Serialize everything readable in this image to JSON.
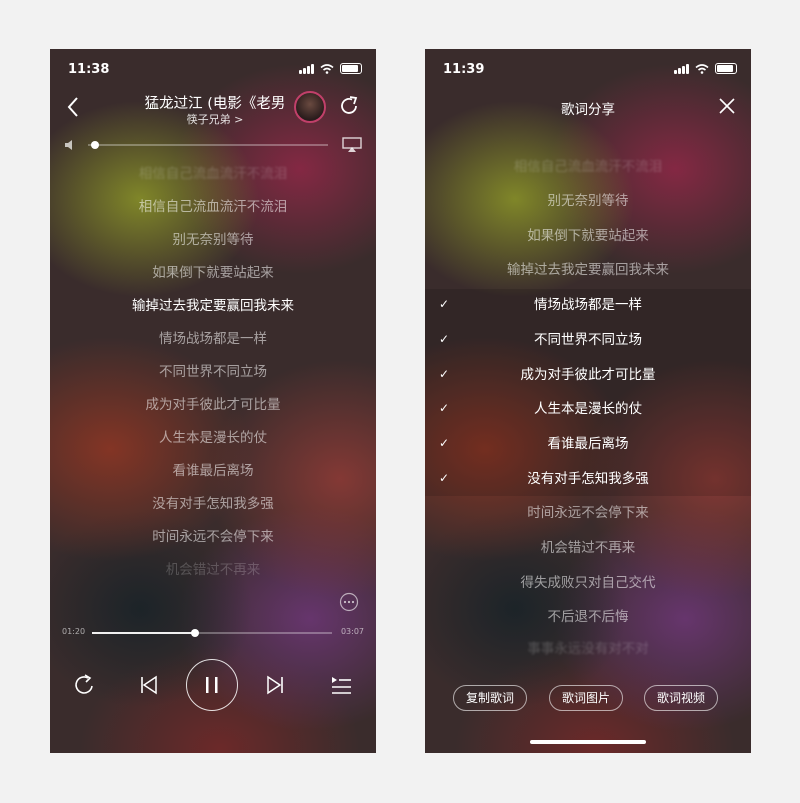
{
  "player": {
    "status_time": "11:38",
    "song_title": "猛龙过江 (电影《老男",
    "artist": "筷子兄弟 >",
    "current_time": "01:20",
    "total_time": "03:07",
    "volume_level": 0.03,
    "progress": 0.43,
    "lyrics": [
      {
        "text": "相信自己流血流汗不流泪",
        "state": "dim"
      },
      {
        "text": "别无奈别等待",
        "state": "dim"
      },
      {
        "text": "如果倒下就要站起来",
        "state": "dim"
      },
      {
        "text": "输掉过去我定要赢回我未来",
        "state": "active"
      },
      {
        "text": "情场战场都是一样",
        "state": "dim"
      },
      {
        "text": "不同世界不同立场",
        "state": "dim"
      },
      {
        "text": "成为对手彼此才可比量",
        "state": "dim"
      },
      {
        "text": "人生本是漫长的仗",
        "state": "dim"
      },
      {
        "text": "看谁最后离场",
        "state": "dim"
      },
      {
        "text": "没有对手怎知我多强",
        "state": "dim"
      },
      {
        "text": "时间永远不会停下来",
        "state": "dim"
      },
      {
        "text": "机会错过不再来",
        "state": "faint"
      }
    ]
  },
  "share": {
    "status_time": "11:39",
    "title": "歌词分享",
    "lyrics": [
      {
        "text": "别无奈别等待",
        "selected": false
      },
      {
        "text": "如果倒下就要站起来",
        "selected": false
      },
      {
        "text": "输掉过去我定要赢回我未来",
        "selected": false
      },
      {
        "text": "情场战场都是一样",
        "selected": true
      },
      {
        "text": "不同世界不同立场",
        "selected": true
      },
      {
        "text": "成为对手彼此才可比量",
        "selected": true
      },
      {
        "text": "人生本是漫长的仗",
        "selected": true
      },
      {
        "text": "看谁最后离场",
        "selected": true
      },
      {
        "text": "没有对手怎知我多强",
        "selected": true
      },
      {
        "text": "时间永远不会停下来",
        "selected": false
      },
      {
        "text": "机会错过不再来",
        "selected": false
      },
      {
        "text": "得失成败只对自己交代",
        "selected": false
      },
      {
        "text": "不后退不后悔",
        "selected": false
      }
    ],
    "buttons": {
      "copy": "复制歌词",
      "image": "歌词图片",
      "video": "歌词视频"
    },
    "check_glyph": "✓"
  },
  "icons": [
    "back-arrow-icon",
    "artist-avatar-icon",
    "share-icon",
    "volume-icon",
    "airplay-icon",
    "more-icon",
    "repeat-icon",
    "previous-icon",
    "pause-icon",
    "next-icon",
    "playlist-icon",
    "close-icon"
  ]
}
